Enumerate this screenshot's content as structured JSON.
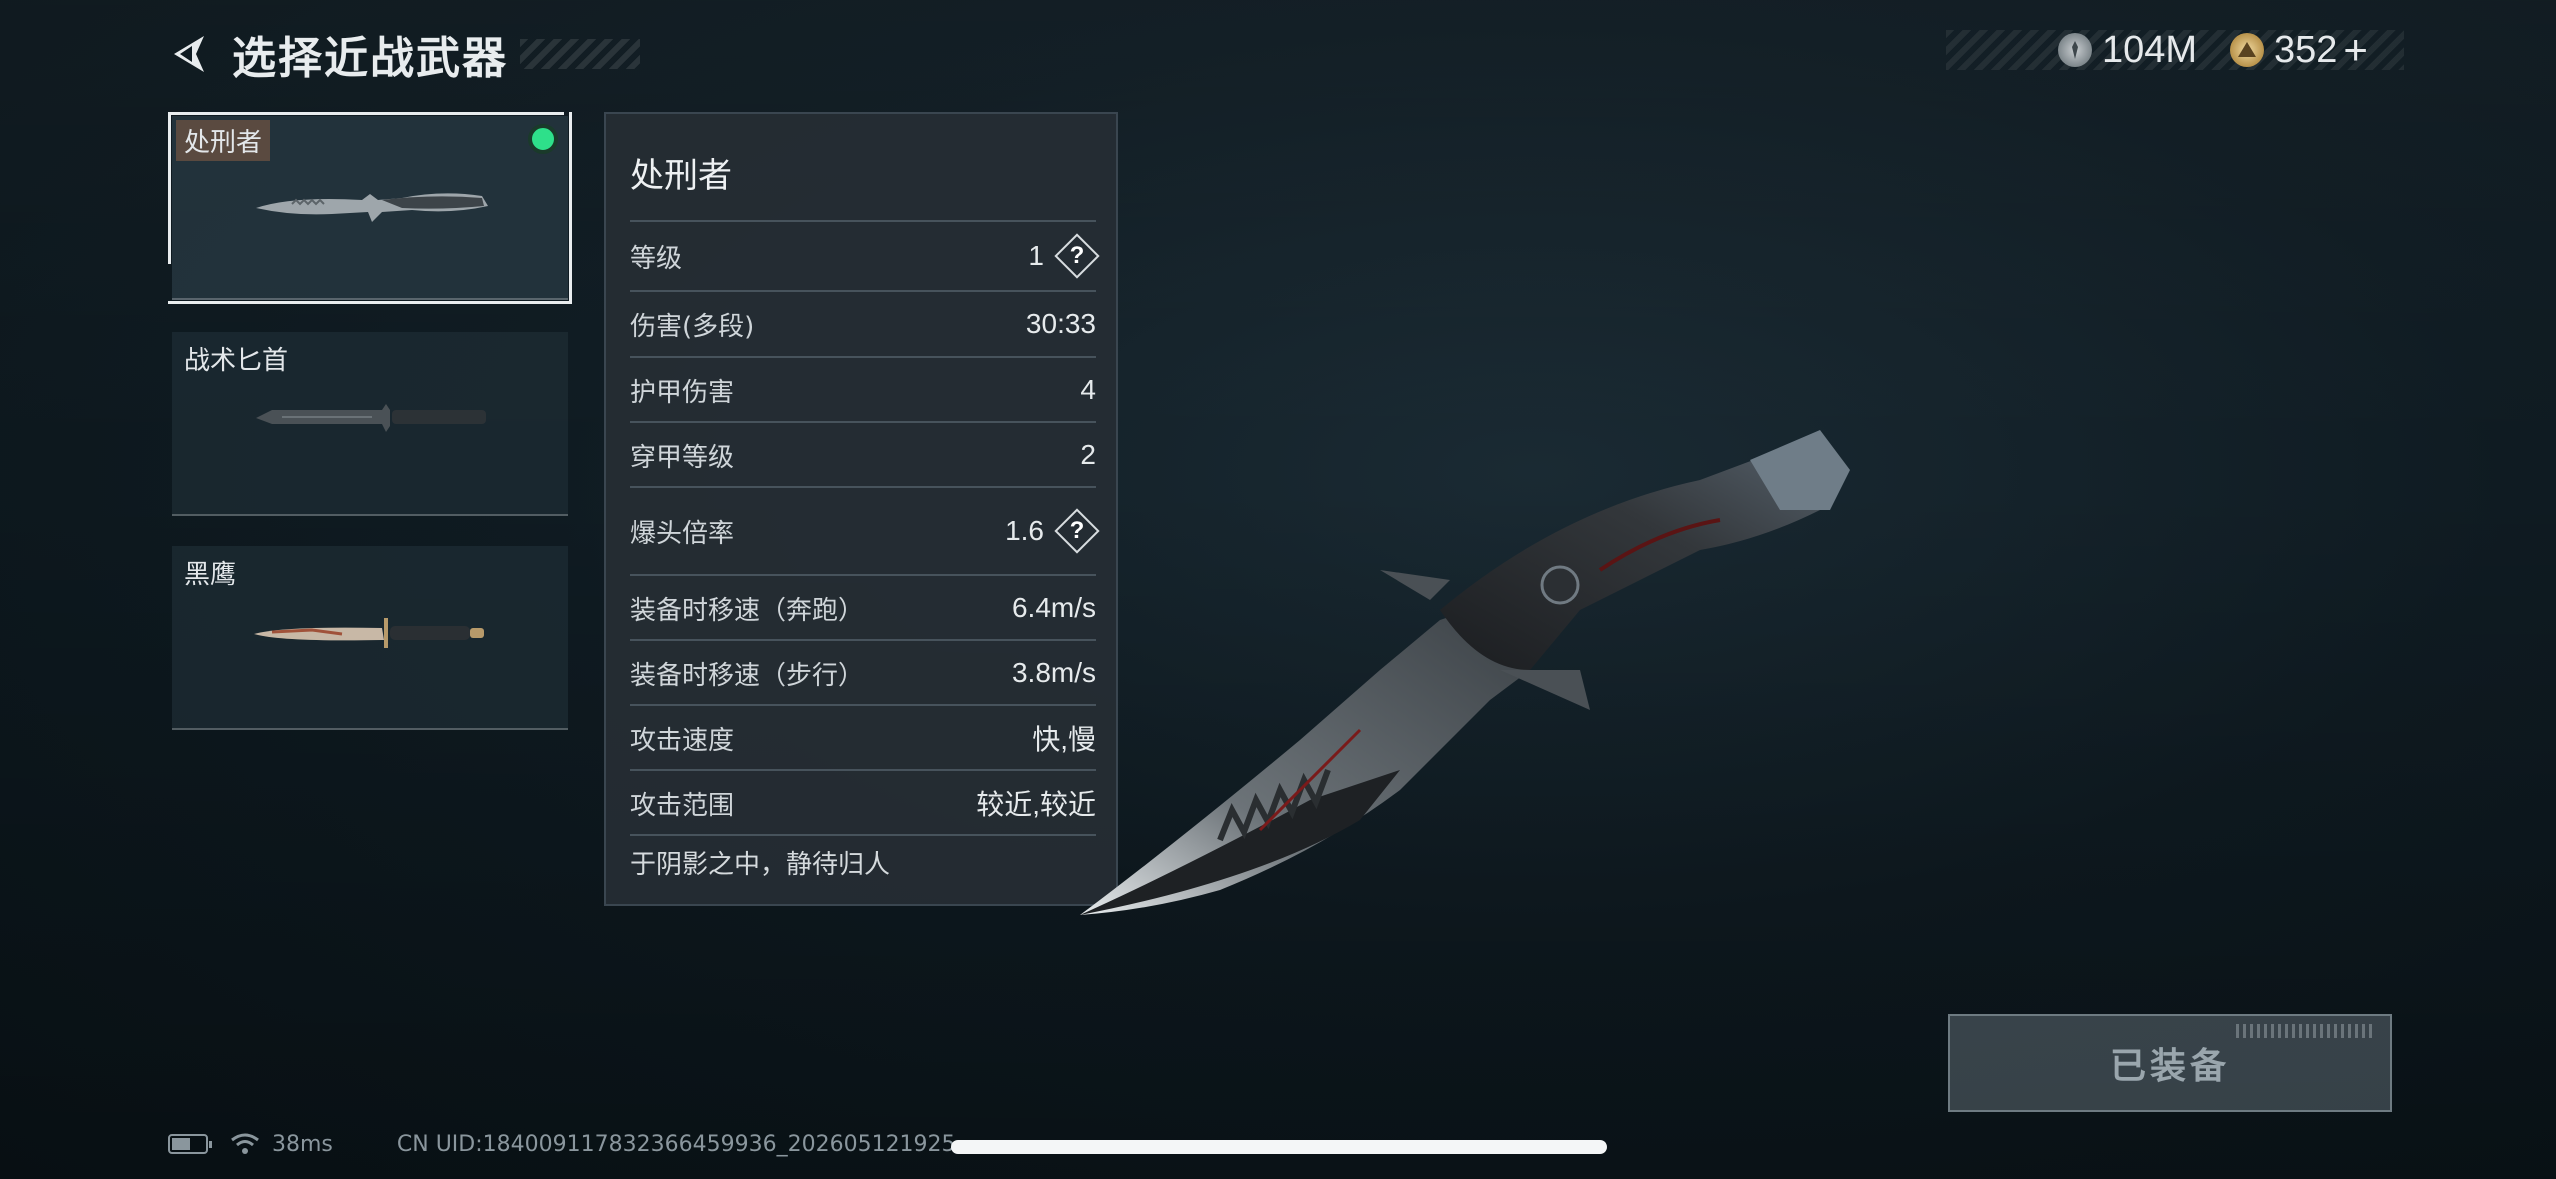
{
  "header": {
    "title": "选择近战武器"
  },
  "currency": {
    "silver_value": "104M",
    "gold_value": "352",
    "plus_label": "+"
  },
  "weapons": [
    {
      "name": "处刑者",
      "selected": true,
      "equipped": true
    },
    {
      "name": "战术匕首",
      "selected": false,
      "equipped": false
    },
    {
      "name": "黑鹰",
      "selected": false,
      "equipped": false
    }
  ],
  "stats": {
    "title": "处刑者",
    "rows": [
      {
        "label": "等级",
        "value": "1"
      },
      {
        "label": "伤害(多段)",
        "value": "30:33"
      },
      {
        "label": "护甲伤害",
        "value": "4"
      },
      {
        "label": "穿甲等级",
        "value": "2"
      },
      {
        "label": "爆头倍率",
        "value": "1.6"
      },
      {
        "label": "装备时移速（奔跑）",
        "value": "6.4m/s"
      },
      {
        "label": "装备时移速（步行）",
        "value": "3.8m/s"
      },
      {
        "label": "攻击速度",
        "value": "快,慢"
      },
      {
        "label": "攻击范围",
        "value": "较近,较近"
      }
    ],
    "help_glyph": "?",
    "description": "于阴影之中，静待归人"
  },
  "equip_button": {
    "label": "已装备"
  },
  "status_bar": {
    "ping": "38ms",
    "uid": "CN UID:18400911783236645993​6_202605121925"
  },
  "colors": {
    "equipped_dot": "#2ee08a",
    "panel_bg": "#262e34",
    "accent_text": "#e8ecee"
  }
}
